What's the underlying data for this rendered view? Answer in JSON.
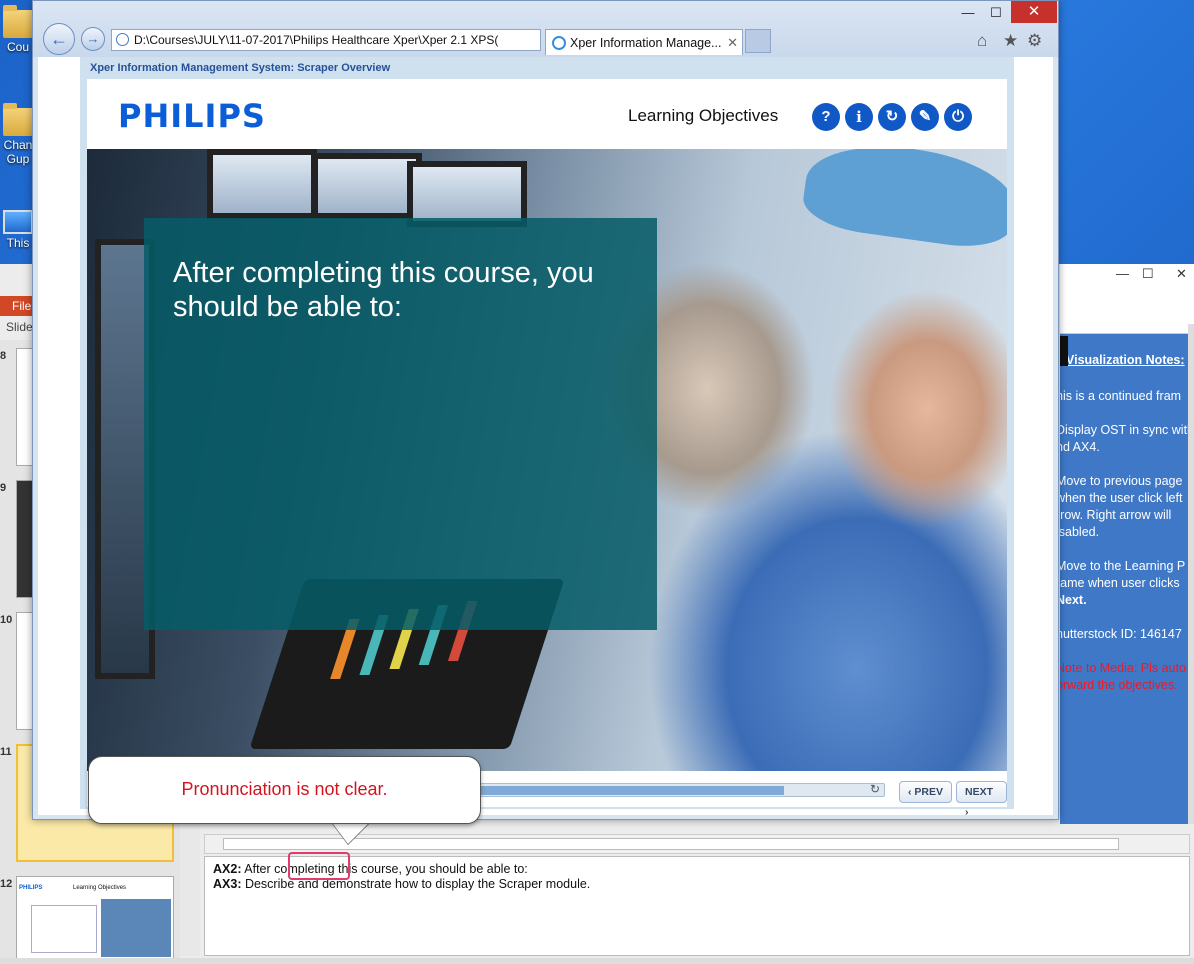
{
  "desktop": {
    "icons": [
      {
        "label": "Cou"
      },
      {
        "label": "Chan"
      },
      {
        "label": "Gup"
      },
      {
        "label": "This"
      }
    ]
  },
  "ppt": {
    "file_tab": "File",
    "slides_label": "Slide",
    "thumb_numbers": [
      "8",
      "9",
      "10",
      "11",
      "12"
    ],
    "thumb12_logo": "PHILIPS",
    "thumb12_heading": "Learning Objectives",
    "notes": {
      "heading": "Visualization Notes:",
      "lines": [
        "his is a continued fram",
        "Display OST in sync with",
        "nd AX4.",
        "Move to previous page",
        "when the user click left",
        "rrow. Right arrow will",
        "isabled.",
        "Move to the Learning P",
        "rame when user clicks",
        "Next.",
        "hutterstock ID: 146147",
        "Note to Media: Pls auto",
        "orward the objectives."
      ]
    },
    "speaker_notes": [
      {
        "tag": "AX2:",
        "text": " After completing this course, you should be able to:"
      },
      {
        "tag": "AX3:",
        "text": " Describe and demonstrate how to display the Scraper module."
      }
    ],
    "colors": {
      "notes_bg": "#3e78c7",
      "file_tab": "#d24726",
      "highlight": "#e03c6c"
    }
  },
  "browser": {
    "address": "D:\\Courses\\JULY\\11-07-2017\\Philips Healthcare Xper\\Xper 2.1 XPS(",
    "tab_title": "Xper Information Manage...",
    "tab_close": "✕",
    "back_icon": "←",
    "forward_icon": "→",
    "home_icon": "⌂",
    "favorites_icon": "★",
    "settings_icon": "⚙",
    "minimize": "—",
    "maximize": "☐",
    "close": "✕"
  },
  "course": {
    "title": "Xper Information Management System: Scraper Overview",
    "logo": "PHILIPS",
    "page_heading": "Learning Objectives",
    "header_buttons": [
      {
        "glyph": "?",
        "name": "help"
      },
      {
        "glyph": "i",
        "name": "info"
      },
      {
        "glyph": "↻",
        "name": "replay"
      },
      {
        "glyph": "✎",
        "name": "notes"
      },
      {
        "glyph": "⏻",
        "name": "exit"
      }
    ],
    "objective_intro": "After completing this course, you should be able to:",
    "progress_percent": 80,
    "prev_label": "PREV",
    "next_label": "NEXT",
    "accent": "#1158c7",
    "teal": "#065c68"
  },
  "comment": {
    "text": "Pronunciation is not clear."
  }
}
